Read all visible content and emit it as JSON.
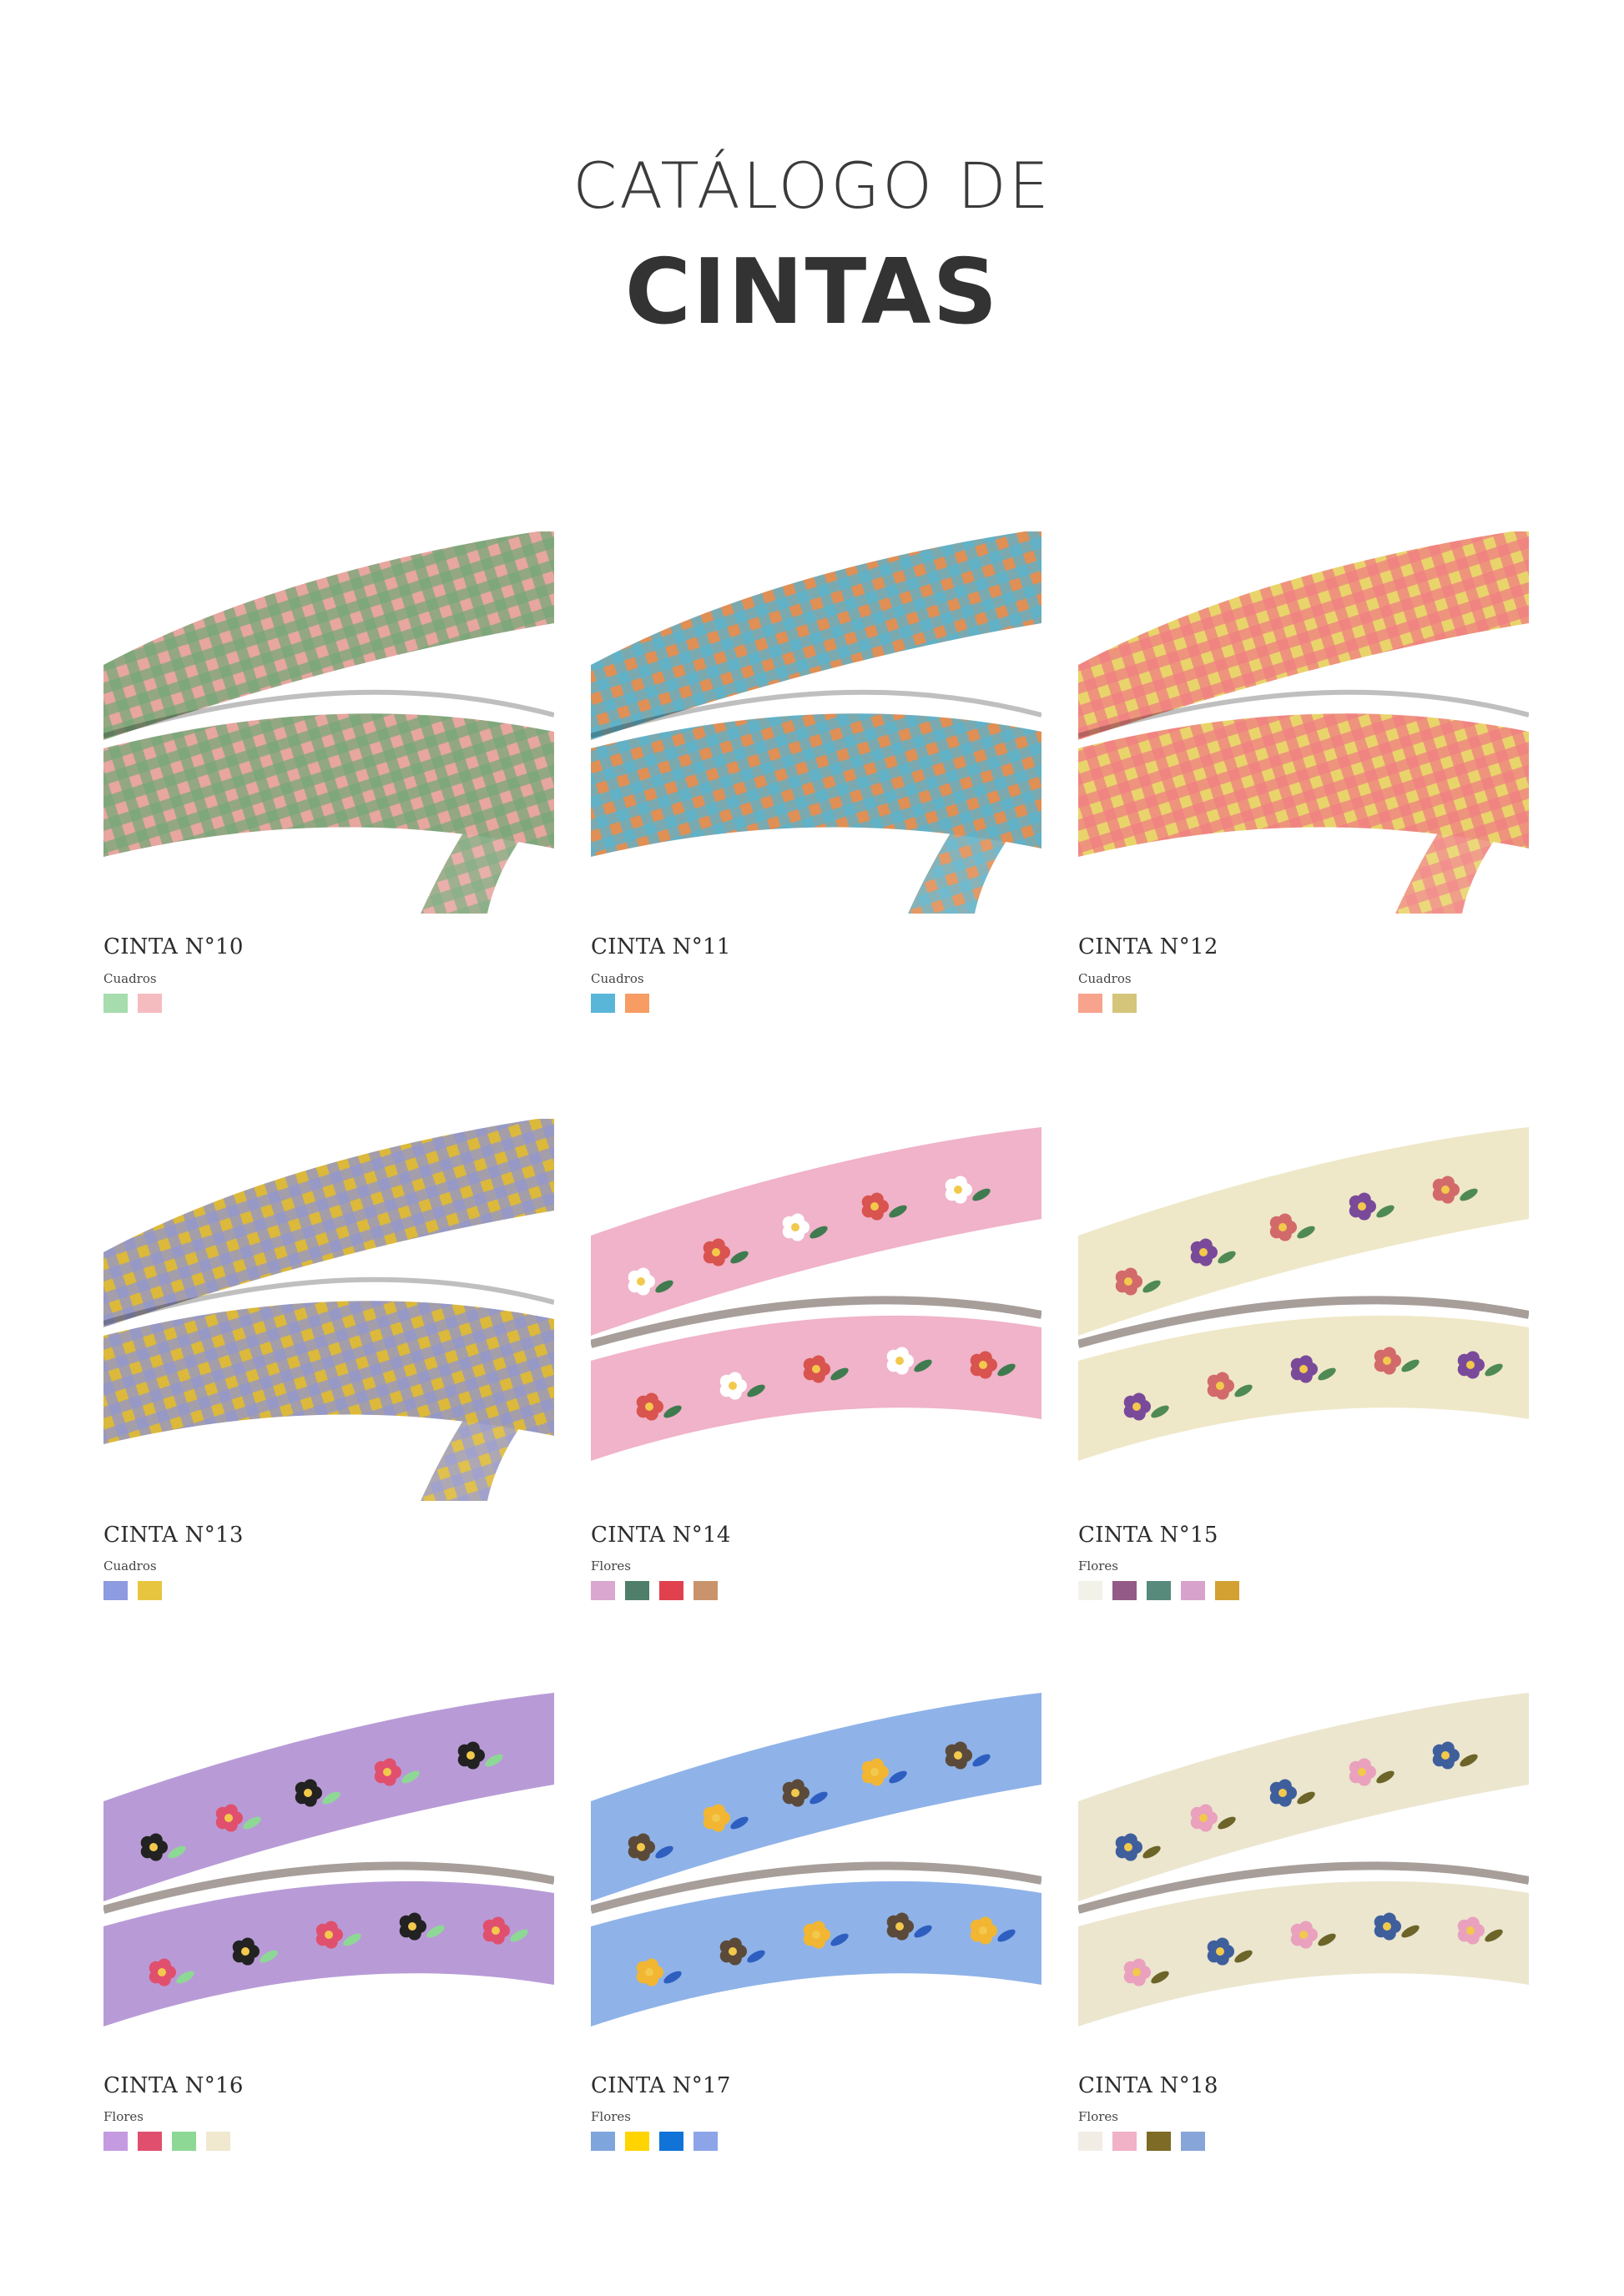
{
  "header": {
    "pre": "CATÁLOGO DE",
    "main": "CINTAS"
  },
  "items": [
    {
      "title": "CINTA N°10",
      "subtitle": "Cuadros",
      "swatches": [
        "#a6dcae",
        "#f5bcc0"
      ],
      "icon": "gingham-ribbon-photo",
      "pattern": "gingham",
      "colors": [
        "#78a779",
        "#e7a6a0"
      ]
    },
    {
      "title": "CINTA N°11",
      "subtitle": "Cuadros",
      "swatches": [
        "#5ab6d8",
        "#f79c63"
      ],
      "icon": "gingham-ribbon-photo",
      "pattern": "gingham",
      "colors": [
        "#58b3cf",
        "#e08f55"
      ]
    },
    {
      "title": "CINTA N°12",
      "subtitle": "Cuadros",
      "swatches": [
        "#f8a38d",
        "#d5c57a"
      ],
      "icon": "gingham-ribbon-photo",
      "pattern": "gingham",
      "colors": [
        "#f07e82",
        "#e9d46b"
      ]
    },
    {
      "title": "CINTA N°13",
      "subtitle": "Cuadros",
      "swatches": [
        "#8d9be0",
        "#e7c53f"
      ],
      "icon": "gingham-ribbon-photo",
      "pattern": "gingham",
      "colors": [
        "#9195cf",
        "#dcb93a"
      ]
    },
    {
      "title": "CINTA N°14",
      "subtitle": "Flores",
      "swatches": [
        "#d9a7cf",
        "#4f7f6a",
        "#e0414c",
        "#c9946b"
      ],
      "icon": "floral-ribbon-photo",
      "pattern": "floral",
      "colors": [
        "#f0b3c9",
        "#d9534f",
        "#3f7b4f",
        "#ffffff"
      ]
    },
    {
      "title": "CINTA N°15",
      "subtitle": "Flores",
      "swatches": [
        "#f3f2e9",
        "#945a87",
        "#588a7c",
        "#d7a2cc",
        "#d2a132"
      ],
      "icon": "floral-ribbon-photo",
      "pattern": "floral",
      "colors": [
        "#efe8c8",
        "#7a4a9a",
        "#4f8a55",
        "#d36a6a"
      ]
    },
    {
      "title": "CINTA N°16",
      "subtitle": "Flores",
      "swatches": [
        "#c49be0",
        "#e0506e",
        "#8ed895",
        "#f0e8cf"
      ],
      "icon": "floral-ribbon-photo",
      "pattern": "floral",
      "colors": [
        "#b89bd6",
        "#e0506e",
        "#8ed895",
        "#222222"
      ]
    },
    {
      "title": "CINTA N°17",
      "subtitle": "Flores",
      "swatches": [
        "#7fa6dc",
        "#ffd400",
        "#1173d8",
        "#8da5e8"
      ],
      "icon": "floral-ribbon-photo",
      "pattern": "floral",
      "colors": [
        "#8fb3e8",
        "#f2b632",
        "#2e5fc0",
        "#5b4a3a"
      ]
    },
    {
      "title": "CINTA N°18",
      "subtitle": "Flores",
      "swatches": [
        "#f1ede5",
        "#f1b1c7",
        "#7d6b26",
        "#87a5d8"
      ],
      "icon": "floral-ribbon-photo",
      "pattern": "floral",
      "colors": [
        "#ece6cf",
        "#e9a1bd",
        "#6c6428",
        "#3f5f9c"
      ]
    }
  ]
}
